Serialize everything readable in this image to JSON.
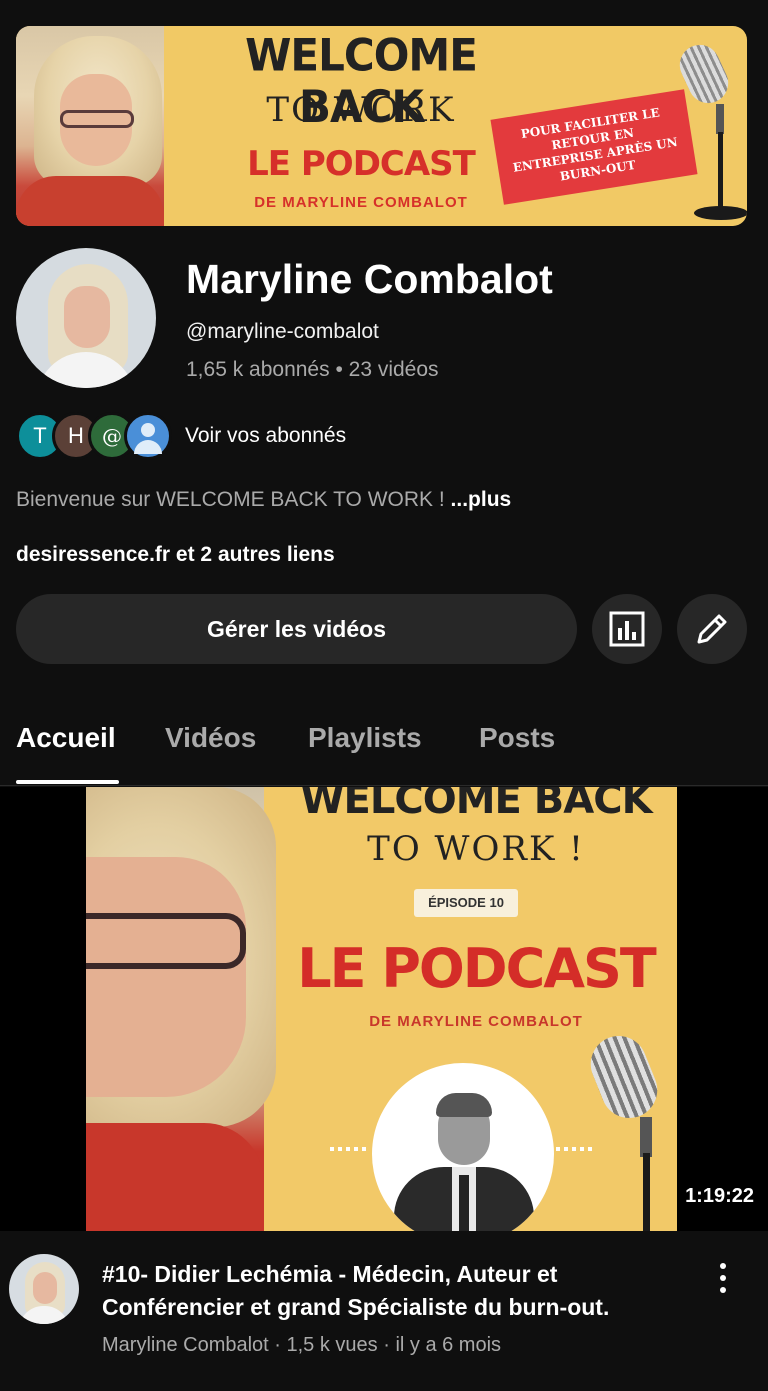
{
  "banner": {
    "line1": "WELCOME BACK",
    "line2": "TO WORK",
    "line3": "LE PODCAST",
    "line4": "DE MARYLINE COMBALOT",
    "tag": "POUR FACILITER LE RETOUR EN ENTREPRISE APRÈS UN BURN-OUT"
  },
  "channel": {
    "name": "Maryline Combalot",
    "handle": "@maryline-combalot",
    "stats": "1,65 k abonnés • 23 vidéos",
    "subscribers_label": "Voir vos abonnés",
    "subscriber_initials": [
      "T",
      "H",
      "@"
    ],
    "description": "Bienvenue sur WELCOME BACK TO WORK ! ",
    "description_more": "...plus",
    "links": "desiressence.fr et 2 autres liens"
  },
  "actions": {
    "manage_label": "Gérer les vidéos",
    "stats_icon": "bar-chart-icon",
    "edit_icon": "pencil-icon"
  },
  "tabs": [
    {
      "label": "Accueil",
      "active": true
    },
    {
      "label": "Vidéos",
      "active": false
    },
    {
      "label": "Playlists",
      "active": false
    },
    {
      "label": "Posts",
      "active": false
    }
  ],
  "featured_video": {
    "thumb_line1": "WELCOME BACK",
    "thumb_line2": "TO WORK !",
    "episode": "ÉPISODE 10",
    "thumb_line3": "LE PODCAST",
    "thumb_line4": "DE MARYLINE COMBALOT",
    "duration": "1:19:22",
    "title": "#10- Didier Lechémia - Médecin, Auteur et Conférencier et grand Spécialiste du burn-out.",
    "meta": "Maryline Combalot · 1,5 k vues · il y a 6 mois"
  },
  "colors": {
    "background": "#0f0f0f",
    "button_bg": "#272727",
    "secondary_text": "#aaaaaa",
    "banner_yellow": "#f1c965",
    "podcast_red": "#d6302a"
  }
}
